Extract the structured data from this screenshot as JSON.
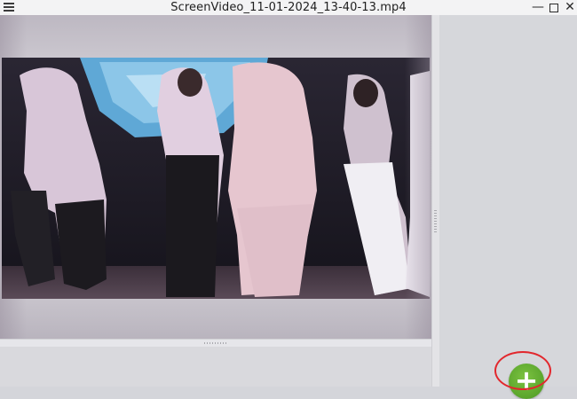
{
  "window": {
    "title": "ScreenVideo_11-01-2024_13-40-13.mp4",
    "minimize_glyph": "—",
    "close_glyph": "✕"
  },
  "icons": {
    "menu": "hamburger-menu-icon",
    "minimize": "minimize-icon",
    "maximize": "maximize-icon",
    "close": "close-icon",
    "add": "plus-icon"
  },
  "side_panel": {
    "add_button_label": "+",
    "add_button_color": "#5aa52c",
    "highlight_color": "#e2272d"
  }
}
